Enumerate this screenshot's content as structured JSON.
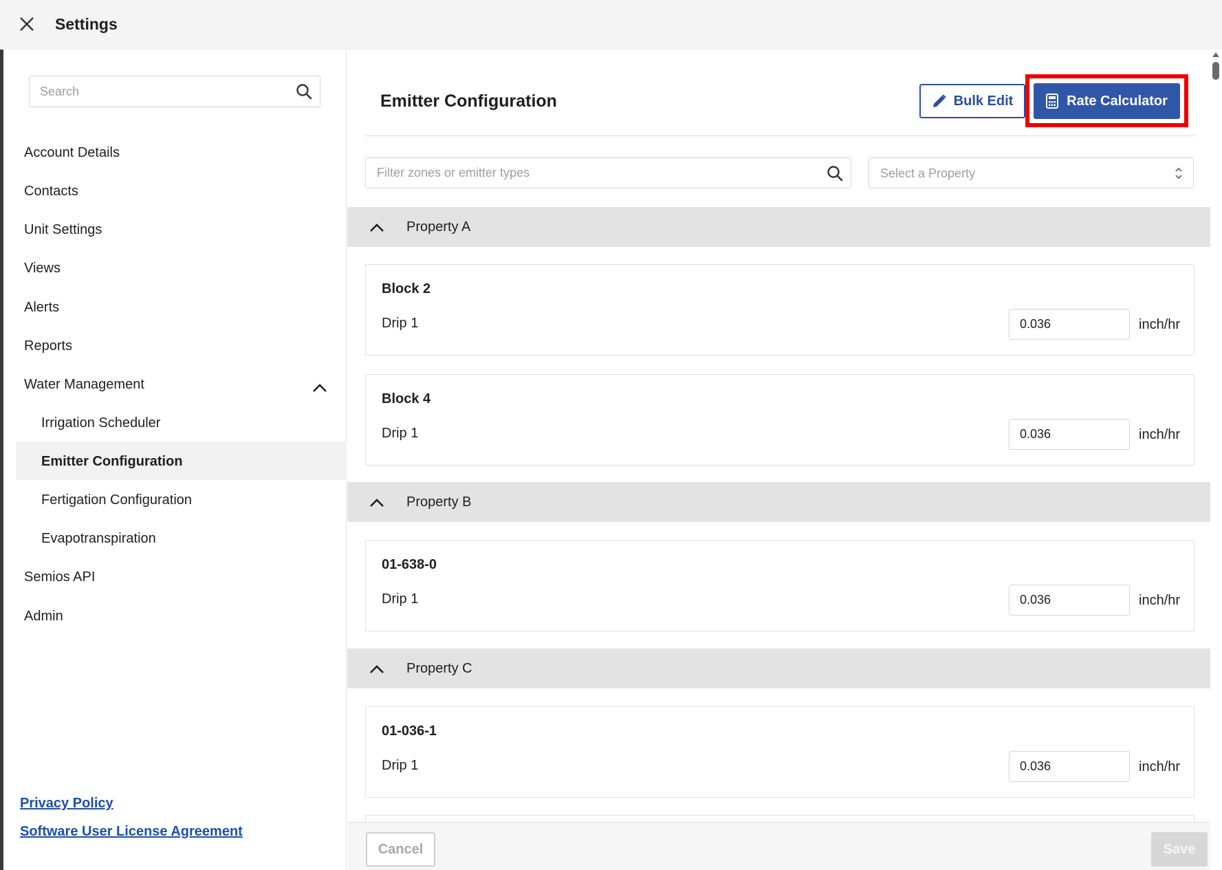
{
  "header": {
    "title": "Settings"
  },
  "sidebar": {
    "search_placeholder": "Search",
    "items": [
      {
        "label": "Account Details"
      },
      {
        "label": "Contacts"
      },
      {
        "label": "Unit Settings"
      },
      {
        "label": "Views"
      },
      {
        "label": "Alerts"
      },
      {
        "label": "Reports"
      },
      {
        "label": "Water Management",
        "expanded": true
      },
      {
        "label": "Semios API"
      },
      {
        "label": "Admin"
      }
    ],
    "sub_items": [
      {
        "label": "Irrigation Scheduler"
      },
      {
        "label": "Emitter Configuration",
        "active": true
      },
      {
        "label": "Fertigation Configuration"
      },
      {
        "label": "Evapotranspiration"
      }
    ],
    "footer_links": [
      {
        "label": "Privacy Policy"
      },
      {
        "label": "Software User License Agreement"
      }
    ]
  },
  "main": {
    "title": "Emitter Configuration",
    "bulk_edit_label": "Bulk Edit",
    "rate_calculator_label": "Rate Calculator",
    "filter_placeholder": "Filter zones or emitter types",
    "property_select_placeholder": "Select a Property",
    "properties": [
      {
        "name": "Property A",
        "blocks": [
          {
            "name": "Block 2",
            "emitter": "Drip 1",
            "rate": "0.036",
            "unit": "inch/hr"
          },
          {
            "name": "Block 4",
            "emitter": "Drip 1",
            "rate": "0.036",
            "unit": "inch/hr"
          }
        ]
      },
      {
        "name": "Property B",
        "blocks": [
          {
            "name": "01-638-0",
            "emitter": "Drip 1",
            "rate": "0.036",
            "unit": "inch/hr"
          }
        ]
      },
      {
        "name": "Property C",
        "blocks": [
          {
            "name": "01-036-1",
            "emitter": "Drip 1",
            "rate": "0.036",
            "unit": "inch/hr"
          }
        ]
      }
    ],
    "cancel_label": "Cancel",
    "save_label": "Save"
  },
  "colors": {
    "primary": "#3056a8",
    "highlight": "#ee0000",
    "link": "#1d4fa8"
  }
}
